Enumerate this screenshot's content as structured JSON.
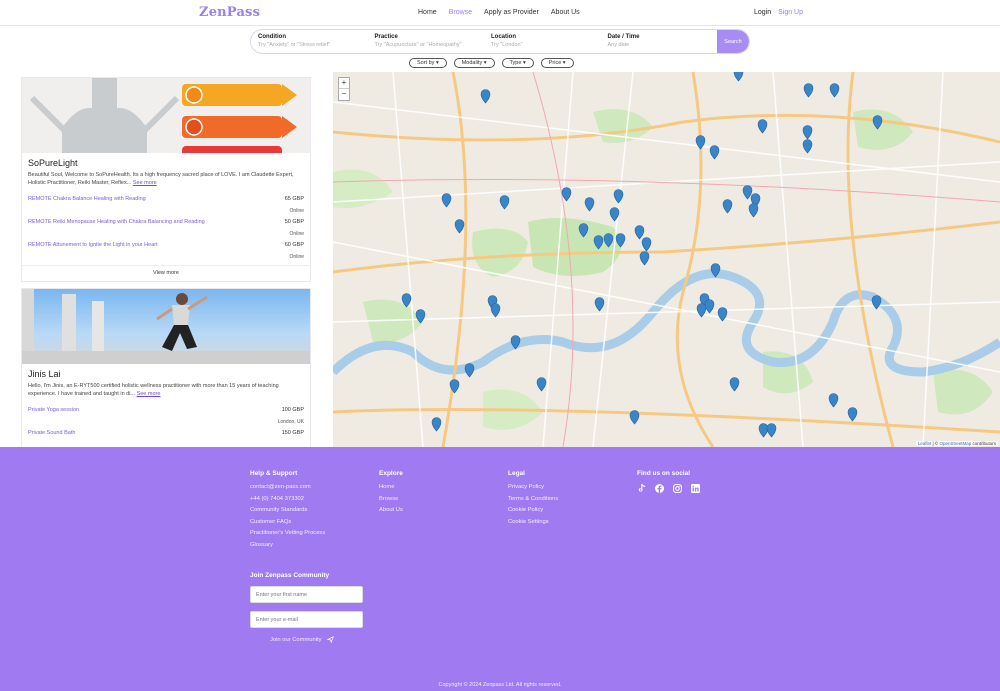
{
  "header": {
    "logo": "ZenPass",
    "nav": [
      "Home",
      "Browse",
      "Apply as Provider",
      "About Us"
    ],
    "active_nav": "Browse",
    "login": "Login",
    "signup": "Sign Up"
  },
  "search": {
    "fields": [
      {
        "label": "Condition",
        "placeholder": "Try \"Anxiety\" or \"Stress relief\""
      },
      {
        "label": "Practice",
        "placeholder": "Try \"Acupuncture\" or \"Homeopathy\""
      },
      {
        "label": "Location",
        "placeholder": "Try \"London\""
      },
      {
        "label": "Date / Time",
        "placeholder": "Any date"
      }
    ],
    "button": "Search"
  },
  "filters": [
    "Sort by ▾",
    "Modality ▾",
    "Type ▾",
    "Price ▾"
  ],
  "listings": [
    {
      "name": "SoPureLight",
      "description": "Beautiful Soul, Welcome to SoPureHealth. Its a high frequency sacred place of LOVE. I am Claudette Expert, Holistic Practitioner, Reiki Master, Reflex...",
      "see_more": "See more",
      "services": [
        {
          "name": "REMOTE Chakra Balance Healing with Reading",
          "price": "65 GBP",
          "location": "Online"
        },
        {
          "name": "REMOTE Reiki Menopause Healing with Chakra Balancing and Reading",
          "price": "50 GBP",
          "location": "Online"
        },
        {
          "name": "REMOTE Attunement to Ignite the Light in your Heart",
          "price": "60 GBP",
          "location": "Online"
        }
      ],
      "view_more": "View more"
    },
    {
      "name": "Jinis Lai",
      "description": "Hello, I'm Jinis, an E-RYT500 certified holistic wellness practitioner with more than 15 years of teaching experience. I have trained and taught in di...",
      "see_more": "See more",
      "services": [
        {
          "name": "Private Yoga session",
          "price": "100 GBP",
          "location": "London, UK"
        },
        {
          "name": "Private Sound Bath",
          "price": "150 GBP",
          "location": ""
        }
      ]
    }
  ],
  "map": {
    "zoom_in": "+",
    "zoom_out": "−",
    "attribution_leaflet": "Leaflet",
    "attribution_sep": " | © ",
    "attribution_osm": "OpenStreetMap",
    "attribution_tail": " contributors"
  },
  "footer": {
    "help": {
      "title": "Help & Support",
      "links": [
        "contact@zen-pass.com",
        "+44 (0) 7404 373302",
        "Community Standards",
        "Customer FAQs",
        "Practitioner's Vetting Process",
        "Glossary"
      ]
    },
    "explore": {
      "title": "Explore",
      "links": [
        "Home",
        "Browse",
        "About Us"
      ]
    },
    "legal": {
      "title": "Legal",
      "links": [
        "Privacy Policy",
        "Terms & Conditions",
        "Cookie Policy",
        "Cookie Settings"
      ]
    },
    "social": {
      "title": "Find us on social",
      "icons": [
        "tiktok-icon",
        "facebook-icon",
        "instagram-icon",
        "linkedin-icon"
      ]
    },
    "join": {
      "title": "Join Zenpass Community",
      "first_name_placeholder": "Enter your first name",
      "email_placeholder": "Enter your e-mail",
      "button": "Join our Community"
    },
    "copyright": "Copyright © 2024 Zenpass Ltd. All rights reserved."
  },
  "colors": {
    "brand": "#a07af0",
    "accent": "#9b7ef0",
    "marker": "#3a84c8"
  }
}
